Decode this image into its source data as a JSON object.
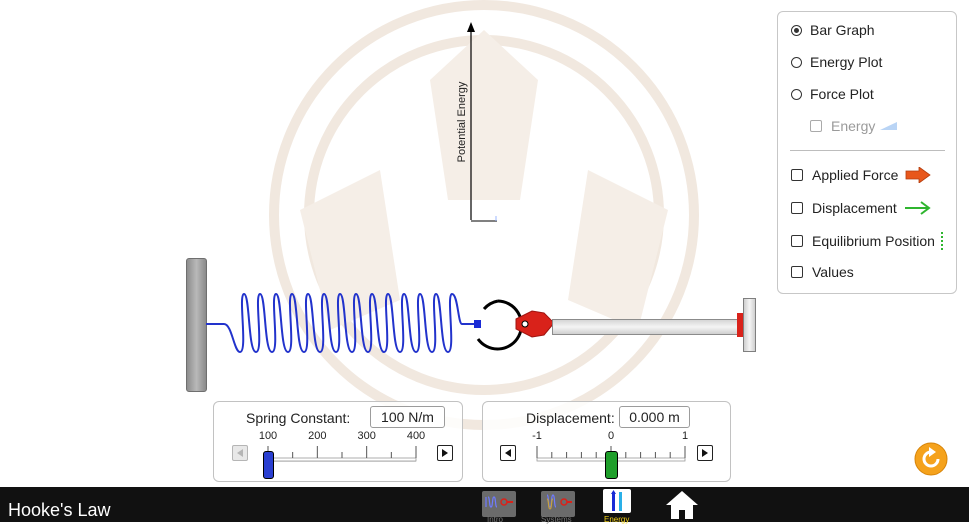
{
  "app": {
    "title": "Hooke's Law"
  },
  "graph": {
    "y_axis_label": "Potential Energy"
  },
  "panel": {
    "radios": [
      {
        "label": "Bar Graph",
        "selected": true
      },
      {
        "label": "Energy Plot",
        "selected": false
      },
      {
        "label": "Force Plot",
        "selected": false
      }
    ],
    "energy_sub": {
      "label": "Energy",
      "enabled": false,
      "checked": false
    },
    "checkboxes": [
      {
        "label": "Applied Force",
        "checked": false,
        "icon": "orange-arrow-icon",
        "color": "#e8571b"
      },
      {
        "label": "Displacement",
        "checked": false,
        "icon": "green-arrow-icon",
        "color": "#2fb52f"
      },
      {
        "label": "Equilibrium Position",
        "checked": false,
        "icon": "green-dashed-line-icon",
        "color": "#2fb52f"
      },
      {
        "label": "Values",
        "checked": false
      }
    ]
  },
  "spring_slider": {
    "label": "Spring Constant:",
    "value": "100 N/m",
    "ticks": [
      "100",
      "200",
      "300",
      "400"
    ],
    "min": 100,
    "max": 400,
    "current": 100,
    "thumb_color": "#2a3fd1"
  },
  "displacement_slider": {
    "label": "Displacement:",
    "value": "0.000 m",
    "ticks": [
      "-1",
      "0",
      "1"
    ],
    "min": -1,
    "max": 1,
    "current": 0,
    "thumb_color": "#1e9e2a"
  },
  "nav": {
    "tabs": [
      {
        "label": "Intro",
        "selected": false
      },
      {
        "label": "Systems",
        "selected": false
      },
      {
        "label": "Energy",
        "selected": true
      }
    ],
    "home_icon": "home-icon",
    "selected_color": "#f2d21a"
  },
  "reset": {
    "icon": "reset-icon",
    "color": "#f5a21c"
  }
}
